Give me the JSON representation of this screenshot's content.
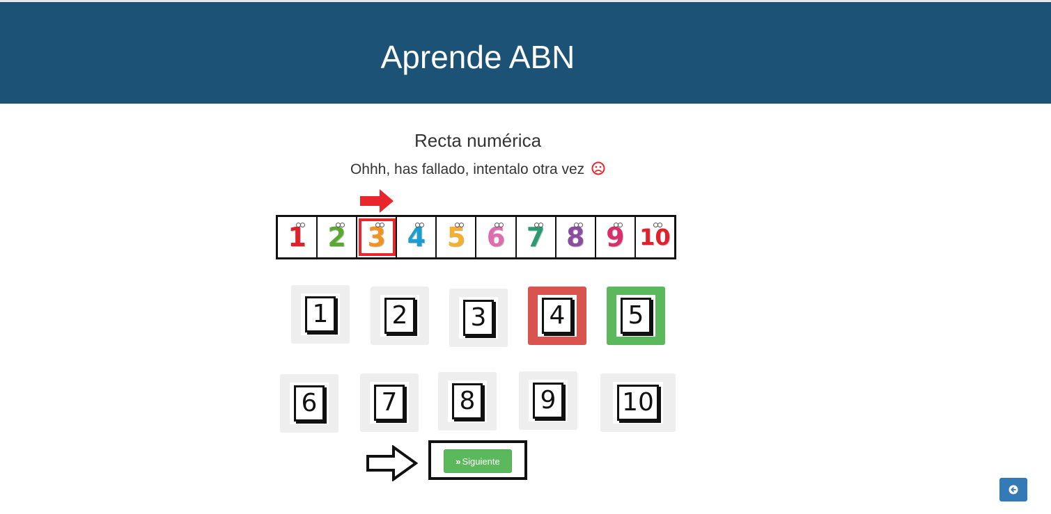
{
  "header": {
    "title": "Aprende ABN"
  },
  "activity": {
    "title": "Recta numérica",
    "feedback": "Ohhh, has fallado, intentalo otra vez",
    "feedback_icon": "frown-icon",
    "feedback_icon_color": "#e8262c"
  },
  "number_line": {
    "items": [
      {
        "label": "1",
        "color": "#e0202a"
      },
      {
        "label": "2",
        "color": "#5aa832"
      },
      {
        "label": "3",
        "color": "#f39221"
      },
      {
        "label": "4",
        "color": "#1a9dcf"
      },
      {
        "label": "5",
        "color": "#f6ae2d"
      },
      {
        "label": "6",
        "color": "#e06cb0"
      },
      {
        "label": "7",
        "color": "#2a9a70"
      },
      {
        "label": "8",
        "color": "#8a4da0"
      },
      {
        "label": "9",
        "color": "#d8306a"
      },
      {
        "label": "10",
        "color": "#e0202a"
      }
    ],
    "highlighted": "3",
    "pointer_color": "#e8262c"
  },
  "options": {
    "row1": [
      "1",
      "2",
      "3",
      "4",
      "5"
    ],
    "row2": [
      "6",
      "7",
      "8",
      "9",
      "10"
    ],
    "wrong": "4",
    "correct": "5"
  },
  "next_button": {
    "label": "Siguiente",
    "color": "#5cb85c"
  },
  "back_button": {
    "icon": "arrow-left-circle-icon",
    "color": "#337ab7"
  },
  "colors": {
    "header": "#1c5275",
    "wrong": "#d9534f",
    "correct": "#5cb85c"
  }
}
